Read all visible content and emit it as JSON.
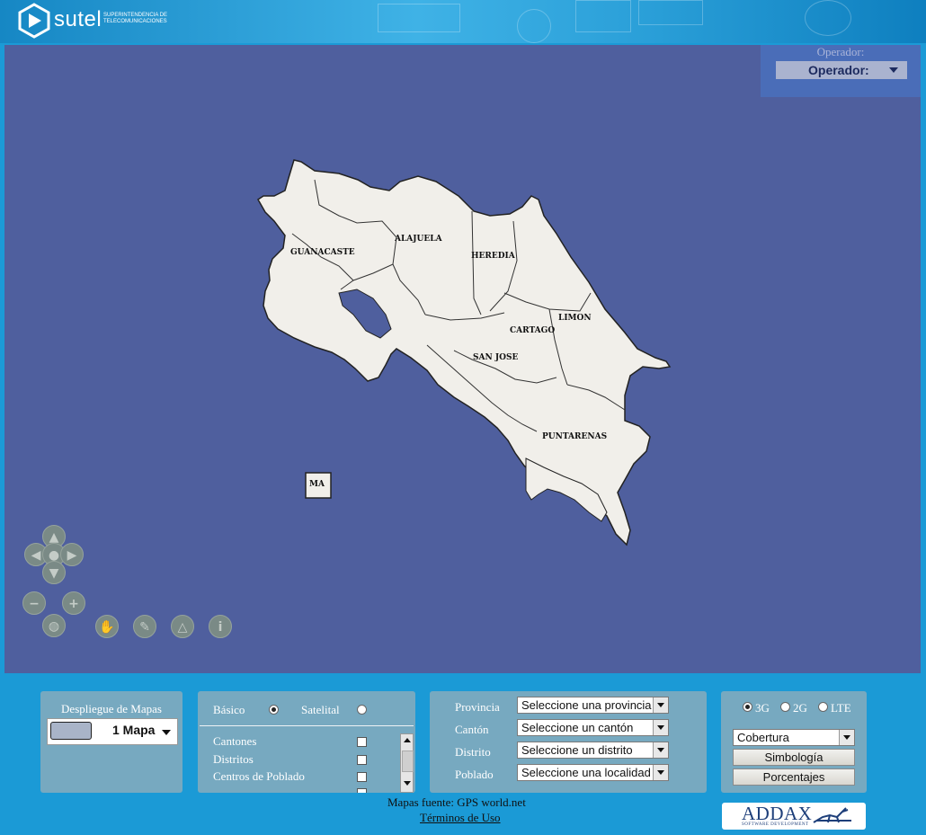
{
  "header": {
    "brand": "sutel",
    "subtitle_line1": "SUPERINTENDENCIA DE",
    "subtitle_line2": "TELECOMUNICACIONES"
  },
  "operator": {
    "label": "Operador:",
    "selected": "Operador:"
  },
  "map": {
    "provinces": [
      "GUANACASTE",
      "ALAJUELA",
      "HEREDIA",
      "LIMON",
      "CARTAGO",
      "SAN JOSE",
      "PUNTARENAS"
    ],
    "island_label": "MA",
    "colors": {
      "sea": "#4f5f9e",
      "land": "#f1efea",
      "border": "#222222"
    }
  },
  "display": {
    "title": "Despliegue de Mapas",
    "option": "1 Mapa"
  },
  "layers": {
    "basic_label": "Básico",
    "satellite_label": "Satelital",
    "items": [
      "Cantones",
      "Distritos",
      "Centros de Poblado"
    ]
  },
  "filters": {
    "provincia_label": "Provincia",
    "provincia_value": "Seleccione una provincia",
    "canton_label": "Cantón",
    "canton_value": "Seleccione un cantón",
    "distrito_label": "Distrito",
    "distrito_value": "Seleccione un distrito",
    "poblado_label": "Poblado",
    "poblado_value": "Seleccione una localidad"
  },
  "tech": {
    "opt_3g": "3G",
    "opt_2g": "2G",
    "opt_lte": "LTE",
    "coverage_value": "Cobertura",
    "symbology_button": "Simbología",
    "percentages_button": "Porcentajes"
  },
  "footer": {
    "source": "Mapas fuente: GPS world.net",
    "terms": "Términos de Uso"
  },
  "addax": {
    "name": "ADDAX",
    "tagline": "SOFTWARE DEVELOPMENT"
  }
}
